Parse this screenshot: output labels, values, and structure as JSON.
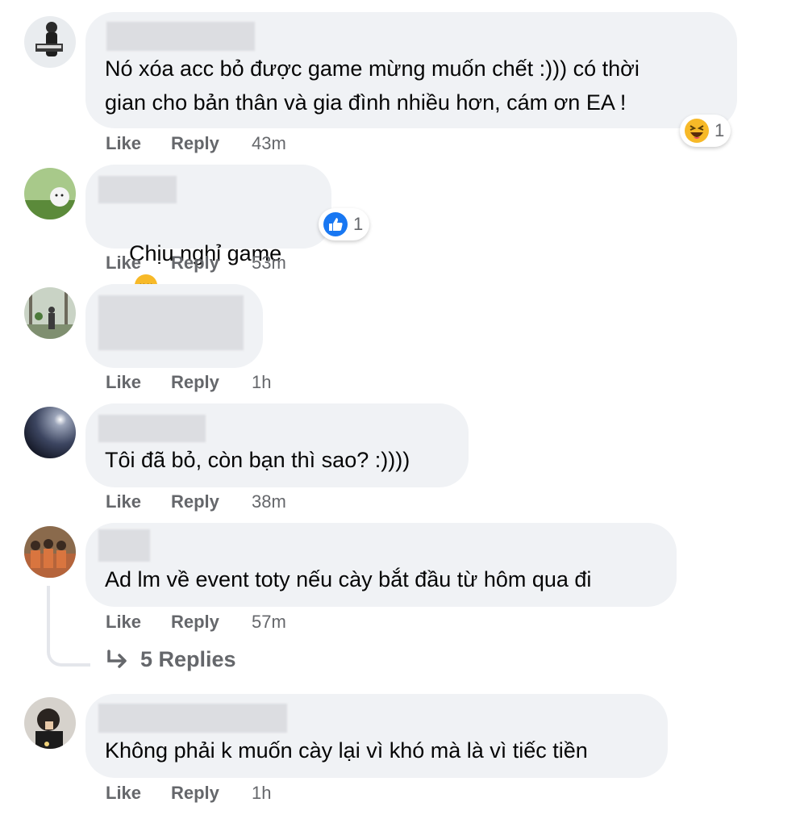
{
  "actions": {
    "like": "Like",
    "reply": "Reply"
  },
  "comments": [
    {
      "text_lines": [
        "Nó xóa acc bỏ được game mừng muốn chết :))) có thời",
        "gian cho bản thân và gia đình nhiều hơn, cám ơn EA !"
      ],
      "time": "43m",
      "reaction": {
        "icon": "haha-emoji-icon",
        "count": "1"
      }
    },
    {
      "text_lines": [
        "Chịu nghỉ game"
      ],
      "inline_emoji": "pensive-emoji-icon",
      "time": "53m",
      "reaction": {
        "icon": "like-reaction-icon",
        "count": "1"
      }
    },
    {
      "text_lines": [],
      "time": "1h"
    },
    {
      "text_lines": [
        "Tôi đã bỏ, còn bạn thì sao? :))))"
      ],
      "time": "38m"
    },
    {
      "text_lines": [
        "Ad lm về event toty nếu cày bắt đầu từ hôm qua đi"
      ],
      "time": "57m",
      "replies_label": "5 Replies"
    },
    {
      "text_lines": [
        "Không phải k muốn cày lại vì khó mà là vì tiếc tiền"
      ],
      "time": "1h"
    }
  ],
  "colors": {
    "bubble": "#f0f2f5",
    "meta": "#65676b",
    "like_blue": "#1877f2",
    "emoji_yellow": "#f7b928"
  }
}
